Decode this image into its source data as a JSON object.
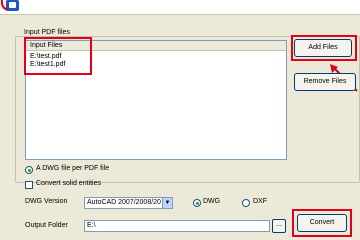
{
  "group": {
    "title": "Input PDF files"
  },
  "list": {
    "header": "Input Files",
    "items": [
      "E:\\test.pdf",
      "E:\\test1.pdf"
    ]
  },
  "buttons": {
    "add_files": "Add Files",
    "remove_files": "Remove Files",
    "convert": "Convert"
  },
  "options": {
    "per_pdf_label": "A DWG file per PDF file",
    "per_pdf_selected": true,
    "solid_entities_label": "Convert solid entities",
    "solid_entities_checked": false
  },
  "dwg_version": {
    "label": "DWG Version",
    "selected": "AutoCAD 2007/2008/20",
    "format_dwg_label": "DWG",
    "format_dxf_label": "DXF",
    "selected_format": "DWG"
  },
  "output": {
    "label": "Output Folder",
    "value": "E:\\",
    "browse_label": "..."
  },
  "colors": {
    "annotation_red": "#e0001b",
    "window_bg": "#ece9d8"
  }
}
